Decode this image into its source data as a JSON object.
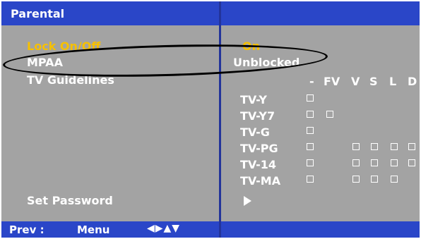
{
  "header": {
    "title": "Parental"
  },
  "menu": {
    "lock": "Lock On/Off",
    "mpaa": "MPAA",
    "tv_guidelines": "TV Guidelines",
    "set_password": "Set Password"
  },
  "values": {
    "lock": "On",
    "mpaa": "Unblocked"
  },
  "columns": [
    "-",
    "FV",
    "V",
    "S",
    "L",
    "D"
  ],
  "ratings": [
    "TV-Y",
    "TV-Y7",
    "TV-G",
    "TV-PG",
    "TV-14",
    "TV-MA"
  ],
  "footer": {
    "prev_label": "Prev :",
    "menu_label": "Menu",
    "arrows": "◀▶▲▼"
  },
  "colors": {
    "accent_blue": "#2a46c8",
    "panel_gray": "#a3a3a3",
    "highlight_yellow": "#f6c000",
    "text_white": "#ffffff"
  }
}
